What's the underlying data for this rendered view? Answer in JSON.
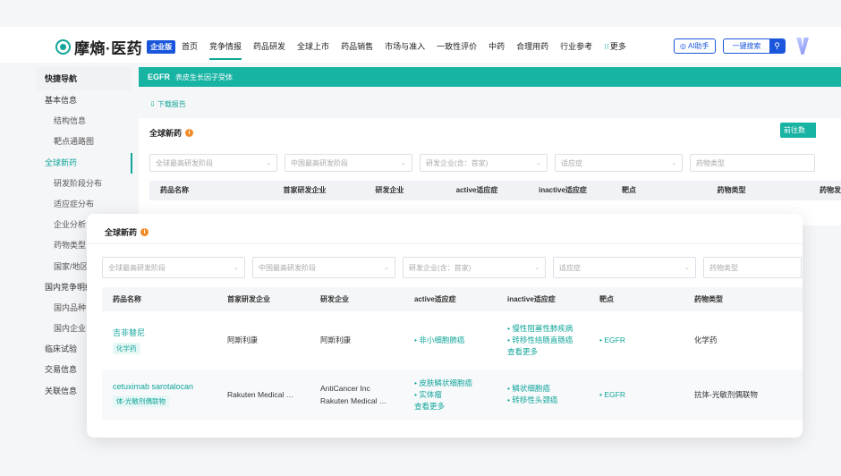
{
  "brand": {
    "name": "摩熵·医药",
    "badge": "企业版"
  },
  "nav": [
    "首页",
    "竞争情报",
    "药品研发",
    "全球上市",
    "药品销售",
    "市场与准入",
    "一致性评价",
    "中药",
    "合理用药",
    "行业参考"
  ],
  "nav_more": "更多",
  "ai_button": "AI助手",
  "search_button": "一键搜索",
  "sidebar": {
    "title": "快捷导航",
    "items": [
      {
        "label": "基本信息",
        "sub": false
      },
      {
        "label": "结构信息",
        "sub": true
      },
      {
        "label": "靶点通路图",
        "sub": true
      },
      {
        "label": "全球新药",
        "sub": false,
        "active": true
      },
      {
        "label": "研发阶段分布",
        "sub": true
      },
      {
        "label": "适应症分布",
        "sub": true
      },
      {
        "label": "企业分析",
        "sub": true
      },
      {
        "label": "药物类型",
        "sub": true
      },
      {
        "label": "国家/地区",
        "sub": true
      },
      {
        "label": "国内竞争明细",
        "sub": false
      },
      {
        "label": "国内品种",
        "sub": true
      },
      {
        "label": "国内企业",
        "sub": true
      },
      {
        "label": "临床试验",
        "sub": false
      },
      {
        "label": "交易信息",
        "sub": false
      },
      {
        "label": "关联信息",
        "sub": false
      }
    ]
  },
  "banner": {
    "title": "EGFR",
    "subtitle": "表皮生长因子受体"
  },
  "download": "下载报告",
  "section_title": "全球新药",
  "goto": "前往数",
  "filters": [
    "全球最高研发阶段",
    "中国最高研发阶段",
    "研发企业(含：首家)",
    "适应症",
    "药物类型"
  ],
  "columns": [
    "药品名称",
    "首家研发企业",
    "研发企业",
    "active适应症",
    "inactive适应症",
    "靶点",
    "药物类型",
    "药物发"
  ],
  "rows": [
    {
      "name": "吉非替尼",
      "tag": "化学药",
      "first_company": "阿斯利康",
      "companies": [
        "阿斯利康"
      ],
      "active": [
        "非小细胞肺癌"
      ],
      "active_more": "",
      "inactive": [
        "慢性阻塞性肺疾病",
        "转移性结肠直肠癌"
      ],
      "inactive_more": "查看更多",
      "target": "EGFR",
      "type": "化学药"
    },
    {
      "name": "cetuximab sarotalocan",
      "tag": "体-光敏剂偶联物",
      "first_company": "Rakuten Medical …",
      "companies": [
        "AntiCancer Inc",
        "Rakuten Medical …"
      ],
      "active": [
        "皮肤鳞状细胞癌",
        "实体瘤"
      ],
      "active_more": "查看更多",
      "inactive": [
        "鳞状细胞癌",
        "转移性头颈癌"
      ],
      "inactive_more": "",
      "target": "EGFR",
      "type": "抗体-光敏剂偶联物"
    }
  ],
  "colors": {
    "accent": "#12a59a",
    "banner": "#17b3a3",
    "brand_blue": "#1a56db",
    "info": "#f28c28"
  }
}
